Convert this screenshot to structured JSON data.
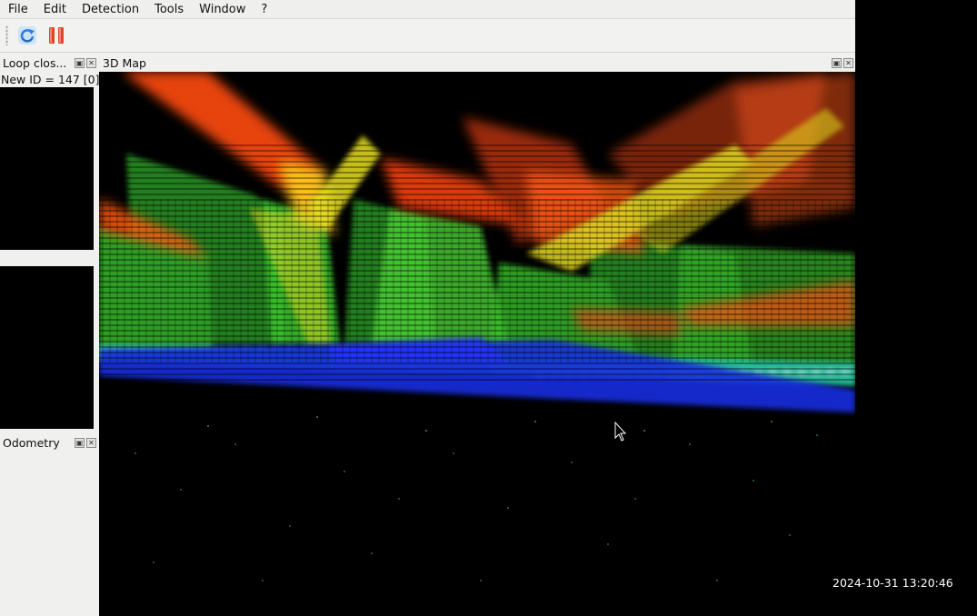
{
  "menu": {
    "items": [
      "File",
      "Edit",
      "Detection",
      "Tools",
      "Window",
      "?"
    ]
  },
  "toolbar": {
    "buttons": [
      {
        "name": "refresh-icon",
        "color": "#2f7ed8"
      },
      {
        "name": "pause-icon",
        "color": "#e0452b"
      }
    ]
  },
  "loop_closure": {
    "title": "Loop clos...",
    "new_id": "New ID = 147 [0]"
  },
  "odometry": {
    "title": "Odometry"
  },
  "map": {
    "title": "3D Map",
    "colors": {
      "high": "#ff4a12",
      "mid_high": "#e8e020",
      "mid": "#3fd72a",
      "low": "#22c7c0",
      "ground": "#1a2ee0"
    }
  },
  "overlay": {
    "timestamp": "2024-10-31 13:20:46"
  }
}
